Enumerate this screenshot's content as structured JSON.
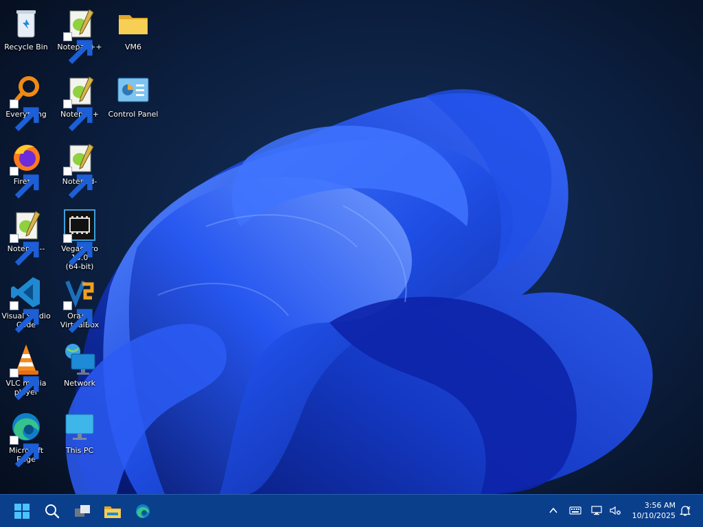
{
  "desktop": {
    "icons": [
      {
        "label": "Recycle Bin",
        "icon": "recycle-bin-icon"
      },
      {
        "label": "Notepad++",
        "icon": "notepad-icon"
      },
      {
        "label": "VM6",
        "icon": "folder-icon"
      },
      {
        "label": "Everything",
        "icon": "search-magnifier-icon"
      },
      {
        "label": "Notepad+",
        "icon": "notepad-icon"
      },
      {
        "label": "Control Panel",
        "icon": "control-panel-icon"
      },
      {
        "label": "Firefox",
        "icon": "firefox-icon"
      },
      {
        "label": "Notepad-",
        "icon": "notepad-icon"
      },
      {
        "label": "Notepad--",
        "icon": "notepad-icon"
      },
      {
        "label": "Vegas Pro 13.0\n(64-bit)",
        "icon": "film-strip-icon"
      },
      {
        "label": "Visual Studio\nCode",
        "icon": "vscode-icon"
      },
      {
        "label": "Oracle\nVirtualBox",
        "icon": "virtualbox-icon"
      },
      {
        "label": "VLC media\nplayer",
        "icon": "vlc-cone-icon"
      },
      {
        "label": "Network",
        "icon": "network-icon"
      },
      {
        "label": "Microsoft Edge",
        "icon": "edge-icon"
      },
      {
        "label": "This PC",
        "icon": "monitor-icon"
      }
    ]
  },
  "taskbar": {
    "start": "windows-logo-icon",
    "search": "search-icon",
    "task_view": "task-view-icon",
    "explorer": "file-explorer-icon",
    "edge": "edge-icon"
  },
  "tray": {
    "chevron": "chevron-up-icon",
    "keyboard": "keyboard-icon",
    "network": "network-status-icon",
    "volume": "volume-muted-icon",
    "notifications": "notification-bell-icon"
  },
  "clock": {
    "time": "3:56 AM",
    "date": "10/10/2025"
  },
  "colors": {
    "taskbar": "#0a3f8c",
    "wallpaper_dark": "#071325",
    "bloom_blue": "#1c4fe0"
  }
}
